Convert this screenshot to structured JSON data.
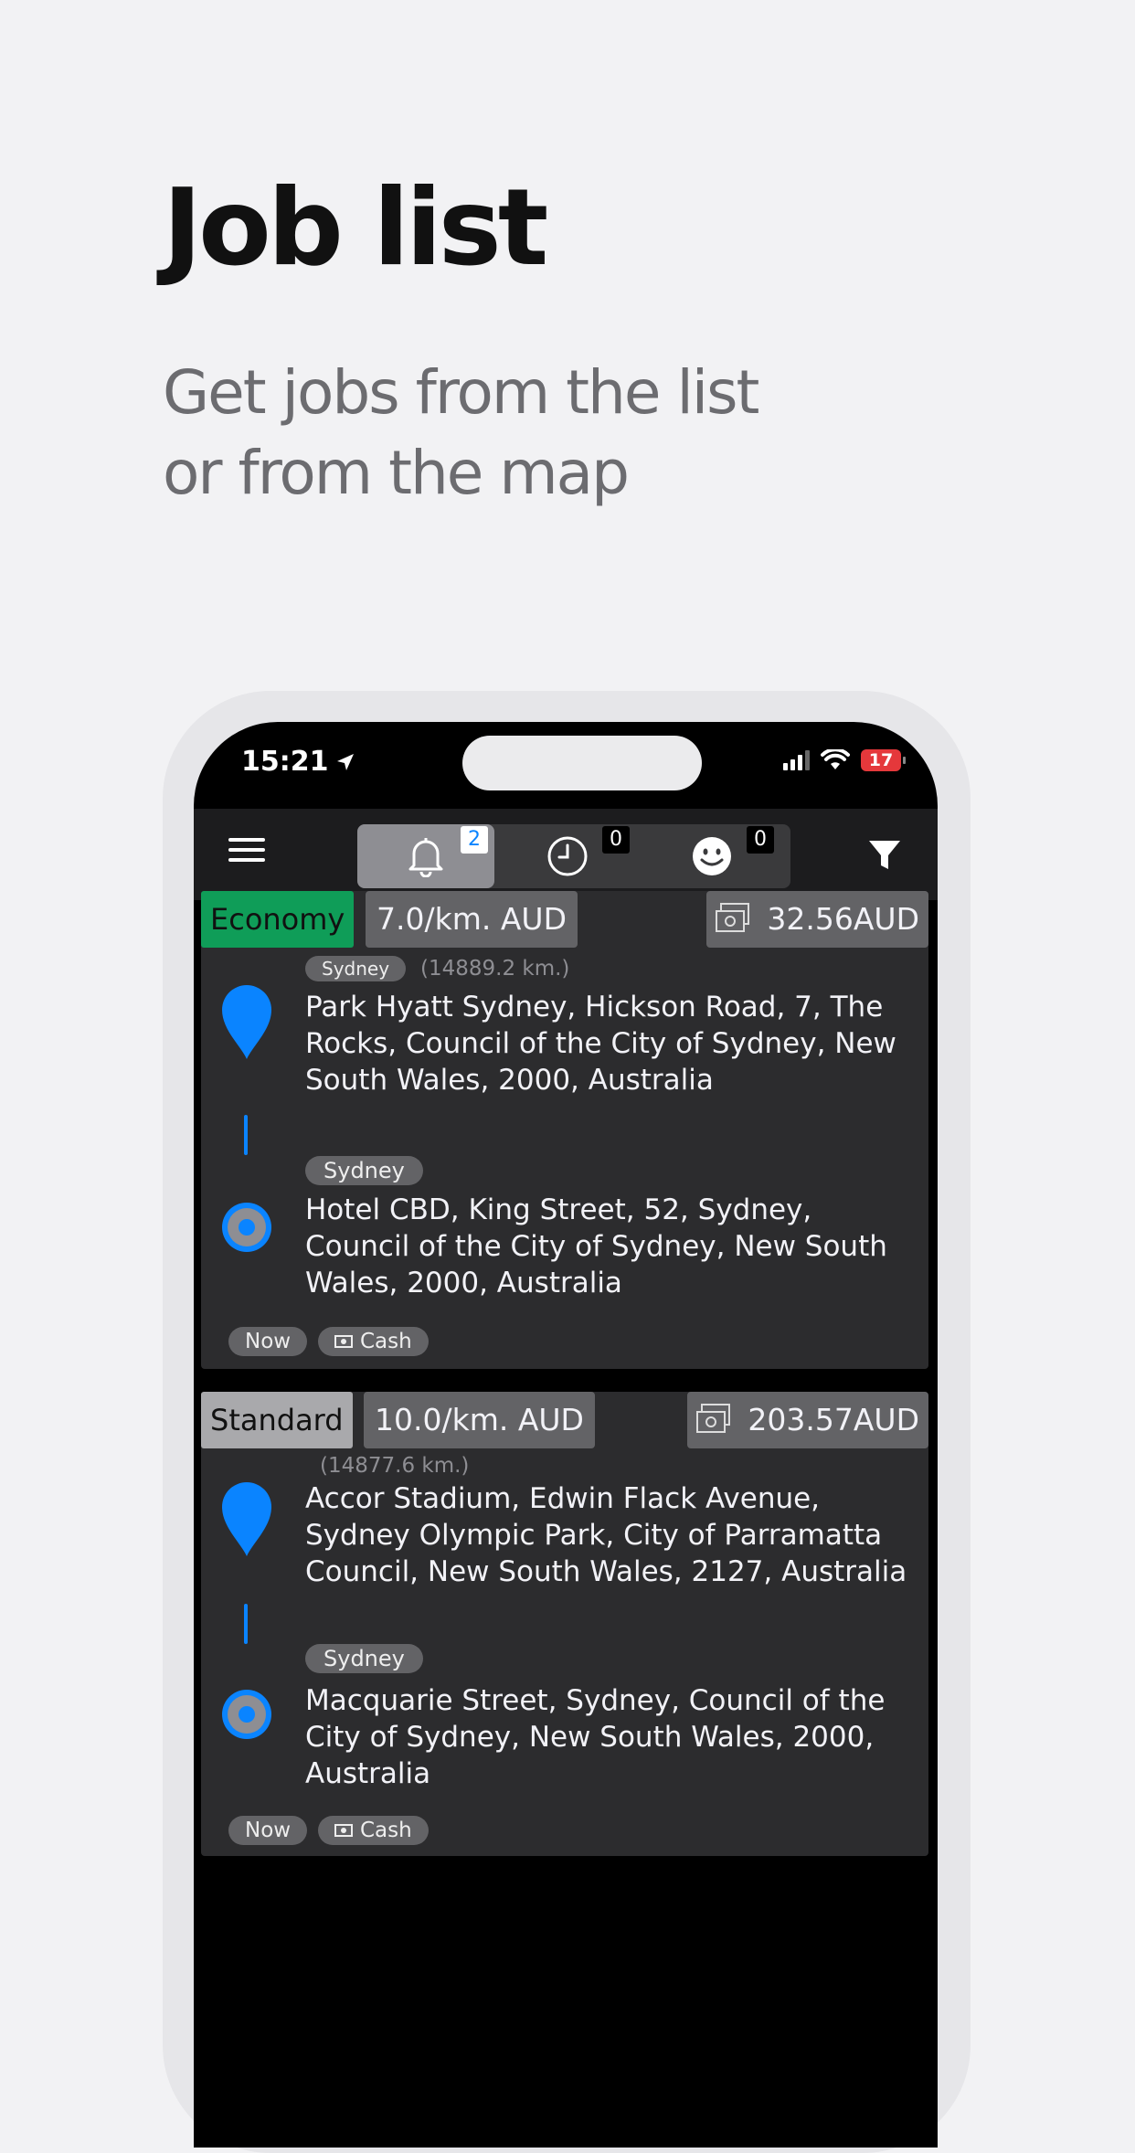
{
  "headline": "Job list",
  "subtitle": [
    "Get jobs from the list",
    "or from the map"
  ],
  "status_bar": {
    "time": "15:21",
    "battery": "17"
  },
  "tabs": [
    {
      "name": "notifications",
      "count": "2"
    },
    {
      "name": "history",
      "count": "0"
    },
    {
      "name": "rating",
      "count": "0"
    }
  ],
  "jobs": [
    {
      "class": "Economy",
      "class_color": "#0f9d58",
      "rate": "7.0/km. AUD",
      "price": "32.56AUD",
      "pickup_city": "Sydney",
      "distance": "(14889.2 km.)",
      "pickup_lines": [
        "Park Hyatt Sydney, Hickson Road, 7, The",
        "Rocks, Council of the City of Sydney, New",
        "South Wales, 2000, Australia"
      ],
      "dropoff_city": "Sydney",
      "dropoff_lines": [
        "Hotel CBD, King Street, 52, Sydney,",
        "Council of the City of Sydney, New South",
        "Wales, 2000, Australia"
      ],
      "time": "Now",
      "payment": "Cash"
    },
    {
      "class": "Standard",
      "class_color": "#a9a9ac",
      "rate": "10.0/km. AUD",
      "price": "203.57AUD",
      "distance": "(14877.6 km.)",
      "pickup_lines": [
        "Accor Stadium, Edwin Flack Avenue,",
        "Sydney Olympic Park, City of Parramatta",
        "Council, New South Wales, 2127, Australia"
      ],
      "dropoff_city": "Sydney",
      "dropoff_lines": [
        "Macquarie Street, Sydney, Council of the",
        "City of Sydney, New South Wales, 2000,",
        "Australia"
      ],
      "time": "Now",
      "payment": "Cash"
    }
  ],
  "colors": {
    "accent": "#0a84ff",
    "economy": "#0f9d58",
    "card": "#2c2c2e",
    "tag": "#636366"
  }
}
